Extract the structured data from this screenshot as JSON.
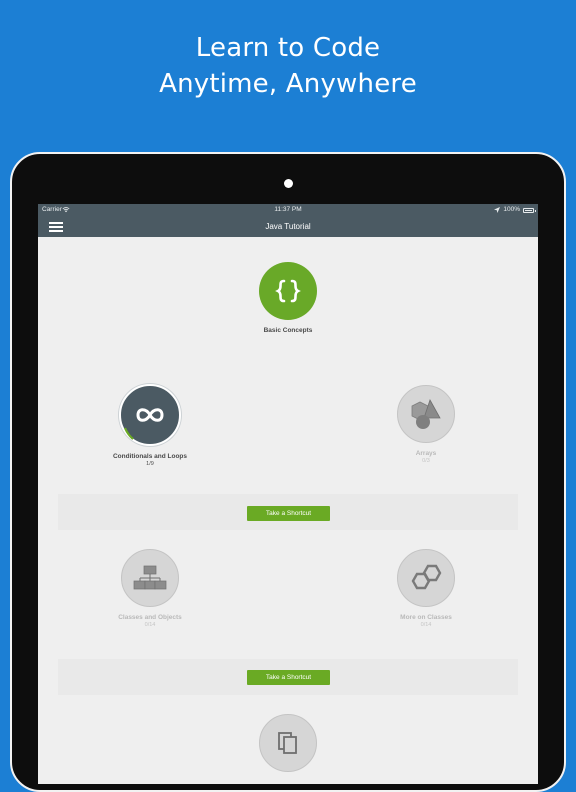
{
  "promo": {
    "line1": "Learn to Code",
    "line2": "Anytime, Anywhere"
  },
  "statusbar": {
    "carrier": "Carrier",
    "time": "11:37 PM",
    "battery": "100%"
  },
  "navbar": {
    "title": "Java Tutorial"
  },
  "lessons": {
    "basic": {
      "title": "Basic Concepts",
      "progress": ""
    },
    "conditionals": {
      "title": "Conditionals and Loops",
      "progress": "1/9"
    },
    "arrays": {
      "title": "Arrays",
      "progress": "0/3"
    },
    "classes": {
      "title": "Classes and Objects",
      "progress": "0/14"
    },
    "more_classes": {
      "title": "More on Classes",
      "progress": "0/14"
    }
  },
  "shortcuts": {
    "first_label": "Take a Shortcut",
    "second_label": "Take a Shortcut"
  },
  "colors": {
    "background": "#1c7fd4",
    "navbar": "#4b5a63",
    "accent_green": "#69a928",
    "locked_grey": "#d6d6d6"
  },
  "icons": {
    "basic": "curly-braces-icon",
    "conditionals": "infinity-icon",
    "arrays": "shapes-icon",
    "classes": "blocks-icon",
    "more_classes": "hexagons-icon",
    "next": "copy-icon"
  }
}
